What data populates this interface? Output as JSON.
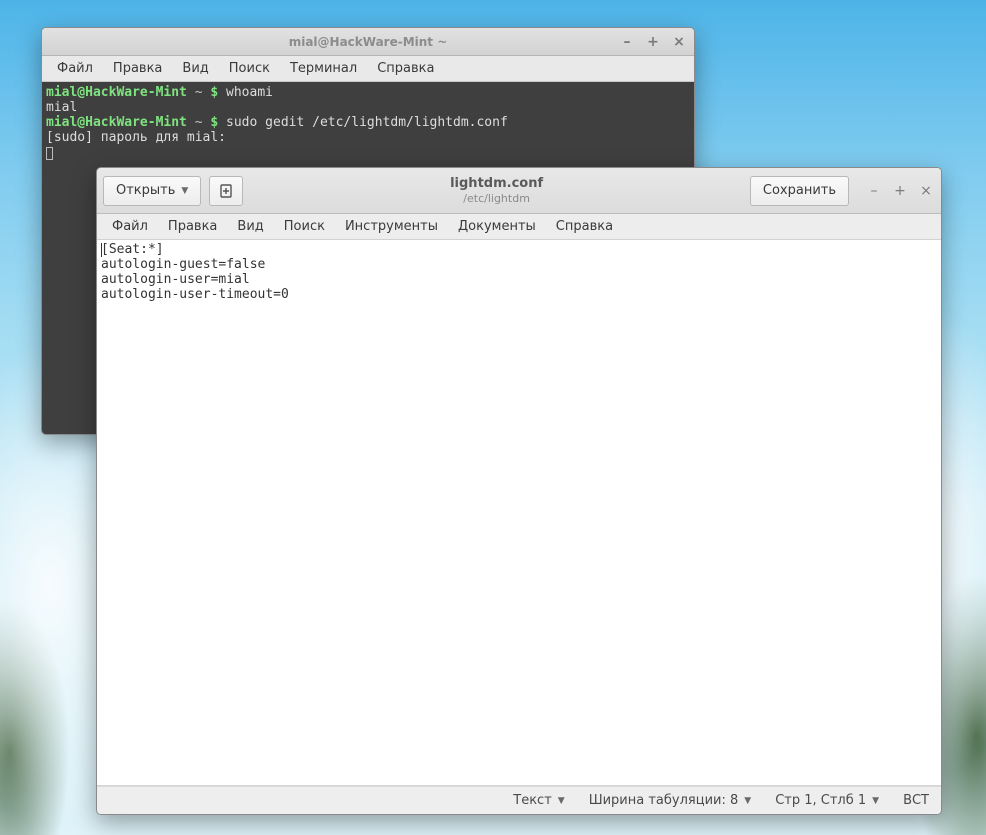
{
  "terminal": {
    "title": "mial@HackWare-Mint ~",
    "menu": [
      "Файл",
      "Правка",
      "Вид",
      "Поиск",
      "Терминал",
      "Справка"
    ],
    "prompt_user_host": "mial@HackWare-Mint",
    "prompt_path": " ~ ",
    "prompt_symbol": "$",
    "lines": {
      "cmd1": "whoami",
      "out1": "mial",
      "cmd2": "sudo gedit /etc/lightdm/lightdm.conf",
      "sudo_prompt": "[sudo] пароль для mial:"
    }
  },
  "gedit": {
    "header": {
      "open_label": "Открыть",
      "title": "lightdm.conf",
      "subtitle": "/etc/lightdm",
      "save_label": "Сохранить"
    },
    "menu": [
      "Файл",
      "Правка",
      "Вид",
      "Поиск",
      "Инструменты",
      "Документы",
      "Справка"
    ],
    "content_lines": [
      "[Seat:*]",
      "autologin-guest=false",
      "autologin-user=mial",
      "autologin-user-timeout=0"
    ],
    "status": {
      "lang": "Текст",
      "tab_width_label": "Ширина табуляции: 8",
      "cursor_pos": "Стр 1, Стлб 1",
      "insert_mode": "ВСТ"
    }
  }
}
